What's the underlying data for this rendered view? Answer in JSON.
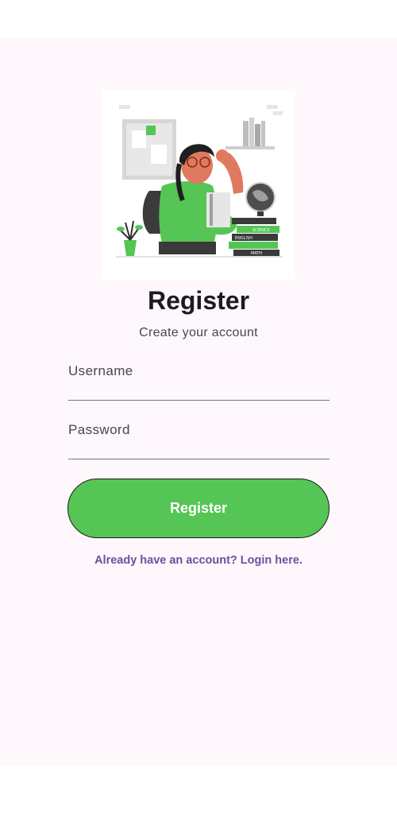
{
  "page": {
    "title": "Register",
    "subtitle": "Create your account"
  },
  "form": {
    "username_label": "Username",
    "username_value": "",
    "password_label": "Password",
    "password_value": ""
  },
  "actions": {
    "register_label": "Register",
    "login_link": "Already have an account? Login here."
  },
  "illustration": {
    "icon": "student-with-books-illustration",
    "book_labels": [
      "SCIENCE",
      "ENGLISH",
      "MATH"
    ]
  },
  "colors": {
    "primary_green": "#55c655",
    "link_purple": "#6750a4",
    "background": "#fef7fb",
    "text_dark": "#1d1b20"
  }
}
